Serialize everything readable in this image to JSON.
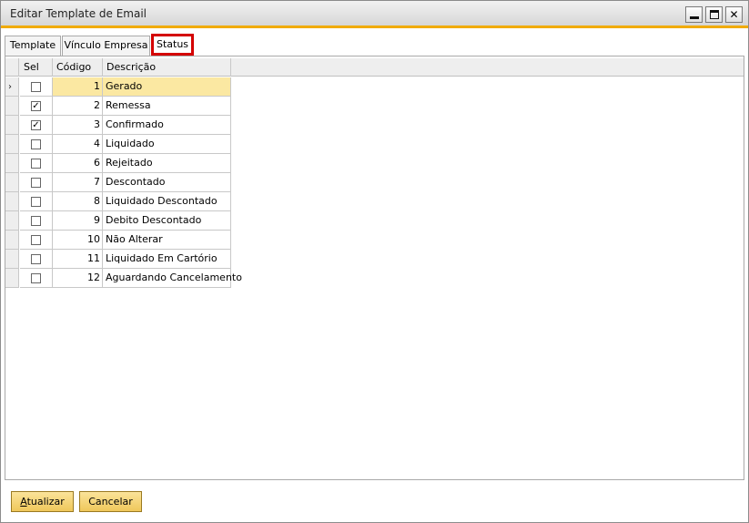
{
  "window": {
    "title": "Editar Template de Email",
    "close_glyph": "✕"
  },
  "tabs": [
    {
      "label": "Template"
    },
    {
      "label": "Vínculo Empresa"
    },
    {
      "label": "Status",
      "active": true,
      "highlight_color": "#d40000"
    }
  ],
  "grid": {
    "columns": [
      "Sel",
      "Código",
      "Descrição"
    ],
    "current_row_marker": "›",
    "rows": [
      {
        "sel": false,
        "codigo": "1",
        "descricao": "Gerado",
        "current": true
      },
      {
        "sel": true,
        "codigo": "2",
        "descricao": "Remessa"
      },
      {
        "sel": true,
        "codigo": "3",
        "descricao": "Confirmado"
      },
      {
        "sel": false,
        "codigo": "4",
        "descricao": "Liquidado"
      },
      {
        "sel": false,
        "codigo": "6",
        "descricao": "Rejeitado"
      },
      {
        "sel": false,
        "codigo": "7",
        "descricao": "Descontado"
      },
      {
        "sel": false,
        "codigo": "8",
        "descricao": "Liquidado Descontado"
      },
      {
        "sel": false,
        "codigo": "9",
        "descricao": "Debito Descontado"
      },
      {
        "sel": false,
        "codigo": "10",
        "descricao": "Não Alterar"
      },
      {
        "sel": false,
        "codigo": "11",
        "descricao": "Liquidado Em Cartório"
      },
      {
        "sel": false,
        "codigo": "12",
        "descricao": "Aguardando Cancelamento"
      }
    ]
  },
  "buttons": {
    "update_accel": "A",
    "update_rest": "tualizar",
    "cancel": "Cancelar"
  },
  "colors": {
    "accent": "#f0ab00",
    "selected_row": "#fbe8a2",
    "button": "#efc75a"
  }
}
